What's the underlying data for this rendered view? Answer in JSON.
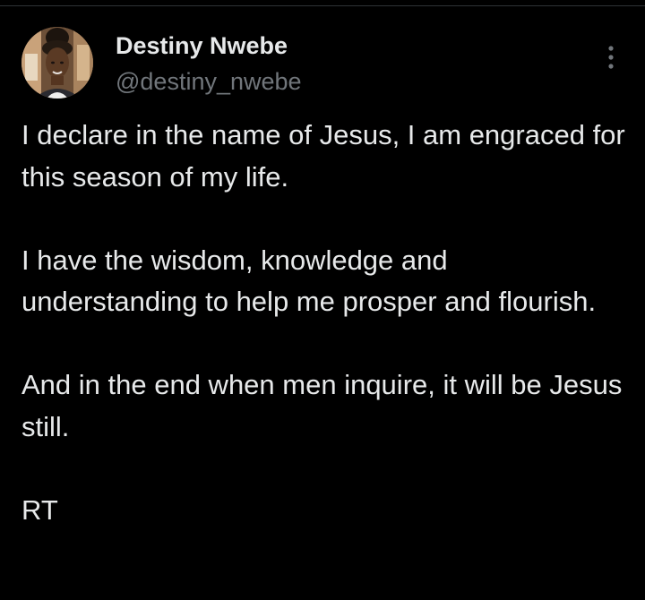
{
  "post": {
    "author": {
      "display_name": "Destiny Nwebe",
      "handle": "@destiny_nwebe",
      "avatar_icon": "profile-photo"
    },
    "more_icon": "more-vertical-icon",
    "paragraphs": [
      "I declare in the name of Jesus, I am engraced for this season of my life.",
      "I have the wisdom, knowledge and understanding to help me prosper and flourish.",
      "And in the end when men inquire, it will be Jesus still.",
      "RT"
    ]
  },
  "colors": {
    "background": "#000000",
    "primary_text": "#e7e9ea",
    "secondary_text": "#71767b",
    "divider": "#2f3336"
  }
}
